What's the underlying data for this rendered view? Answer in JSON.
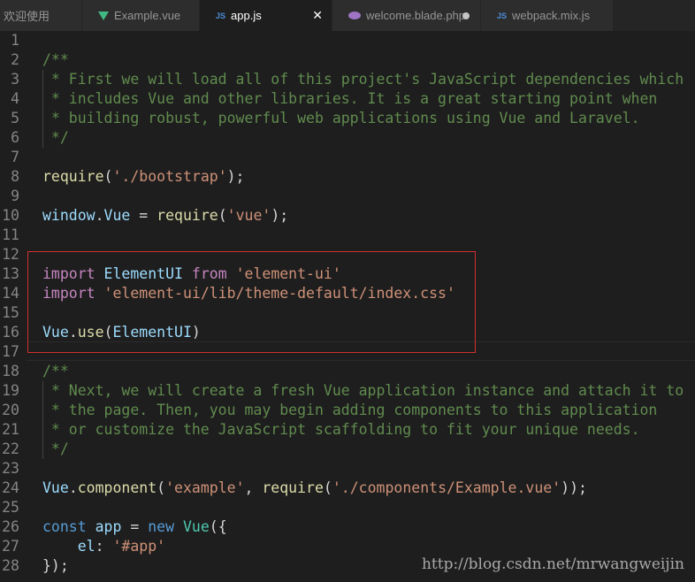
{
  "tabs": [
    {
      "label": "欢迎使用",
      "icon": "none",
      "active": false
    },
    {
      "label": "Example.vue",
      "icon": "vue-icon",
      "active": false
    },
    {
      "label": "app.js",
      "icon": "js-icon",
      "icon_text": "JS",
      "active": true,
      "close": "✕"
    },
    {
      "label": "welcome.blade.php",
      "icon": "php-icon",
      "active": false,
      "dirty": true
    },
    {
      "label": "webpack.mix.js",
      "icon": "js-icon",
      "icon_text": "JS",
      "active": false
    }
  ],
  "editor": {
    "lines": [
      {
        "n": "1",
        "tokens": []
      },
      {
        "n": "2",
        "tokens": [
          {
            "t": "/**",
            "c": "comment"
          }
        ]
      },
      {
        "n": "3",
        "tokens": [
          {
            "t": " * First we will load all of this project's JavaScript dependencies which",
            "c": "comment"
          }
        ]
      },
      {
        "n": "4",
        "tokens": [
          {
            "t": " * includes Vue and other libraries. It is a great starting point when",
            "c": "comment"
          }
        ]
      },
      {
        "n": "5",
        "tokens": [
          {
            "t": " * building robust, powerful web applications using Vue and Laravel.",
            "c": "comment"
          }
        ]
      },
      {
        "n": "6",
        "tokens": [
          {
            "t": " */",
            "c": "comment"
          }
        ]
      },
      {
        "n": "7",
        "tokens": []
      },
      {
        "n": "8",
        "tokens": [
          {
            "t": "require",
            "c": "fn"
          },
          {
            "t": "(",
            "c": "plain"
          },
          {
            "t": "'./bootstrap'",
            "c": "string"
          },
          {
            "t": ");",
            "c": "plain"
          }
        ]
      },
      {
        "n": "9",
        "tokens": []
      },
      {
        "n": "10",
        "tokens": [
          {
            "t": "window",
            "c": "ident"
          },
          {
            "t": ".",
            "c": "plain"
          },
          {
            "t": "Vue",
            "c": "ident"
          },
          {
            "t": " = ",
            "c": "plain"
          },
          {
            "t": "require",
            "c": "fn"
          },
          {
            "t": "(",
            "c": "plain"
          },
          {
            "t": "'vue'",
            "c": "string"
          },
          {
            "t": ");",
            "c": "plain"
          }
        ]
      },
      {
        "n": "11",
        "tokens": []
      },
      {
        "n": "12",
        "tokens": []
      },
      {
        "n": "13",
        "tokens": [
          {
            "t": "import",
            "c": "kw-purple"
          },
          {
            "t": " ",
            "c": "plain"
          },
          {
            "t": "ElementUI",
            "c": "ident"
          },
          {
            "t": " ",
            "c": "plain"
          },
          {
            "t": "from",
            "c": "kw-purple"
          },
          {
            "t": " ",
            "c": "plain"
          },
          {
            "t": "'element-ui'",
            "c": "string"
          }
        ]
      },
      {
        "n": "14",
        "tokens": [
          {
            "t": "import",
            "c": "kw-purple"
          },
          {
            "t": " ",
            "c": "plain"
          },
          {
            "t": "'element-ui/lib/theme-default/index.css'",
            "c": "string"
          }
        ]
      },
      {
        "n": "15",
        "tokens": []
      },
      {
        "n": "16",
        "tokens": [
          {
            "t": "Vue",
            "c": "ident"
          },
          {
            "t": ".",
            "c": "plain"
          },
          {
            "t": "use",
            "c": "fn"
          },
          {
            "t": "(",
            "c": "plain"
          },
          {
            "t": "ElementUI",
            "c": "ident"
          },
          {
            "t": ")",
            "c": "plain"
          }
        ]
      },
      {
        "n": "17",
        "tokens": []
      },
      {
        "n": "18",
        "tokens": [
          {
            "t": "/**",
            "c": "comment"
          }
        ]
      },
      {
        "n": "19",
        "tokens": [
          {
            "t": " * Next, we will create a fresh Vue application instance and attach it to",
            "c": "comment"
          }
        ]
      },
      {
        "n": "20",
        "tokens": [
          {
            "t": " * the page. Then, you may begin adding components to this application",
            "c": "comment"
          }
        ]
      },
      {
        "n": "21",
        "tokens": [
          {
            "t": " * or customize the JavaScript scaffolding to fit your unique needs.",
            "c": "comment"
          }
        ]
      },
      {
        "n": "22",
        "tokens": [
          {
            "t": " */",
            "c": "comment"
          }
        ]
      },
      {
        "n": "23",
        "tokens": []
      },
      {
        "n": "24",
        "tokens": [
          {
            "t": "Vue",
            "c": "ident"
          },
          {
            "t": ".",
            "c": "plain"
          },
          {
            "t": "component",
            "c": "fn"
          },
          {
            "t": "(",
            "c": "plain"
          },
          {
            "t": "'example'",
            "c": "string"
          },
          {
            "t": ", ",
            "c": "plain"
          },
          {
            "t": "require",
            "c": "fn"
          },
          {
            "t": "(",
            "c": "plain"
          },
          {
            "t": "'./components/Example.vue'",
            "c": "string"
          },
          {
            "t": "));",
            "c": "plain"
          }
        ]
      },
      {
        "n": "25",
        "tokens": []
      },
      {
        "n": "26",
        "tokens": [
          {
            "t": "const",
            "c": "keyword"
          },
          {
            "t": " ",
            "c": "plain"
          },
          {
            "t": "app",
            "c": "ident"
          },
          {
            "t": " = ",
            "c": "plain"
          },
          {
            "t": "new",
            "c": "keyword"
          },
          {
            "t": " ",
            "c": "plain"
          },
          {
            "t": "Vue",
            "c": "class"
          },
          {
            "t": "({",
            "c": "plain"
          }
        ]
      },
      {
        "n": "27",
        "tokens": [
          {
            "t": "    ",
            "c": "plain"
          },
          {
            "t": "el",
            "c": "ident"
          },
          {
            "t": ": ",
            "c": "plain"
          },
          {
            "t": "'#app'",
            "c": "string"
          }
        ]
      },
      {
        "n": "28",
        "tokens": [
          {
            "t": "});",
            "c": "plain"
          }
        ]
      }
    ]
  },
  "watermark": "http://blog.csdn.net/mrwangweijin",
  "colors": {
    "background": "#1e1e1e",
    "tab_bar": "#252526",
    "comment": "#608b4e",
    "string": "#ce9178",
    "keyword": "#569cd6",
    "import": "#c586c0",
    "identifier": "#9cdcfe",
    "highlight_box": "#d0302c"
  }
}
